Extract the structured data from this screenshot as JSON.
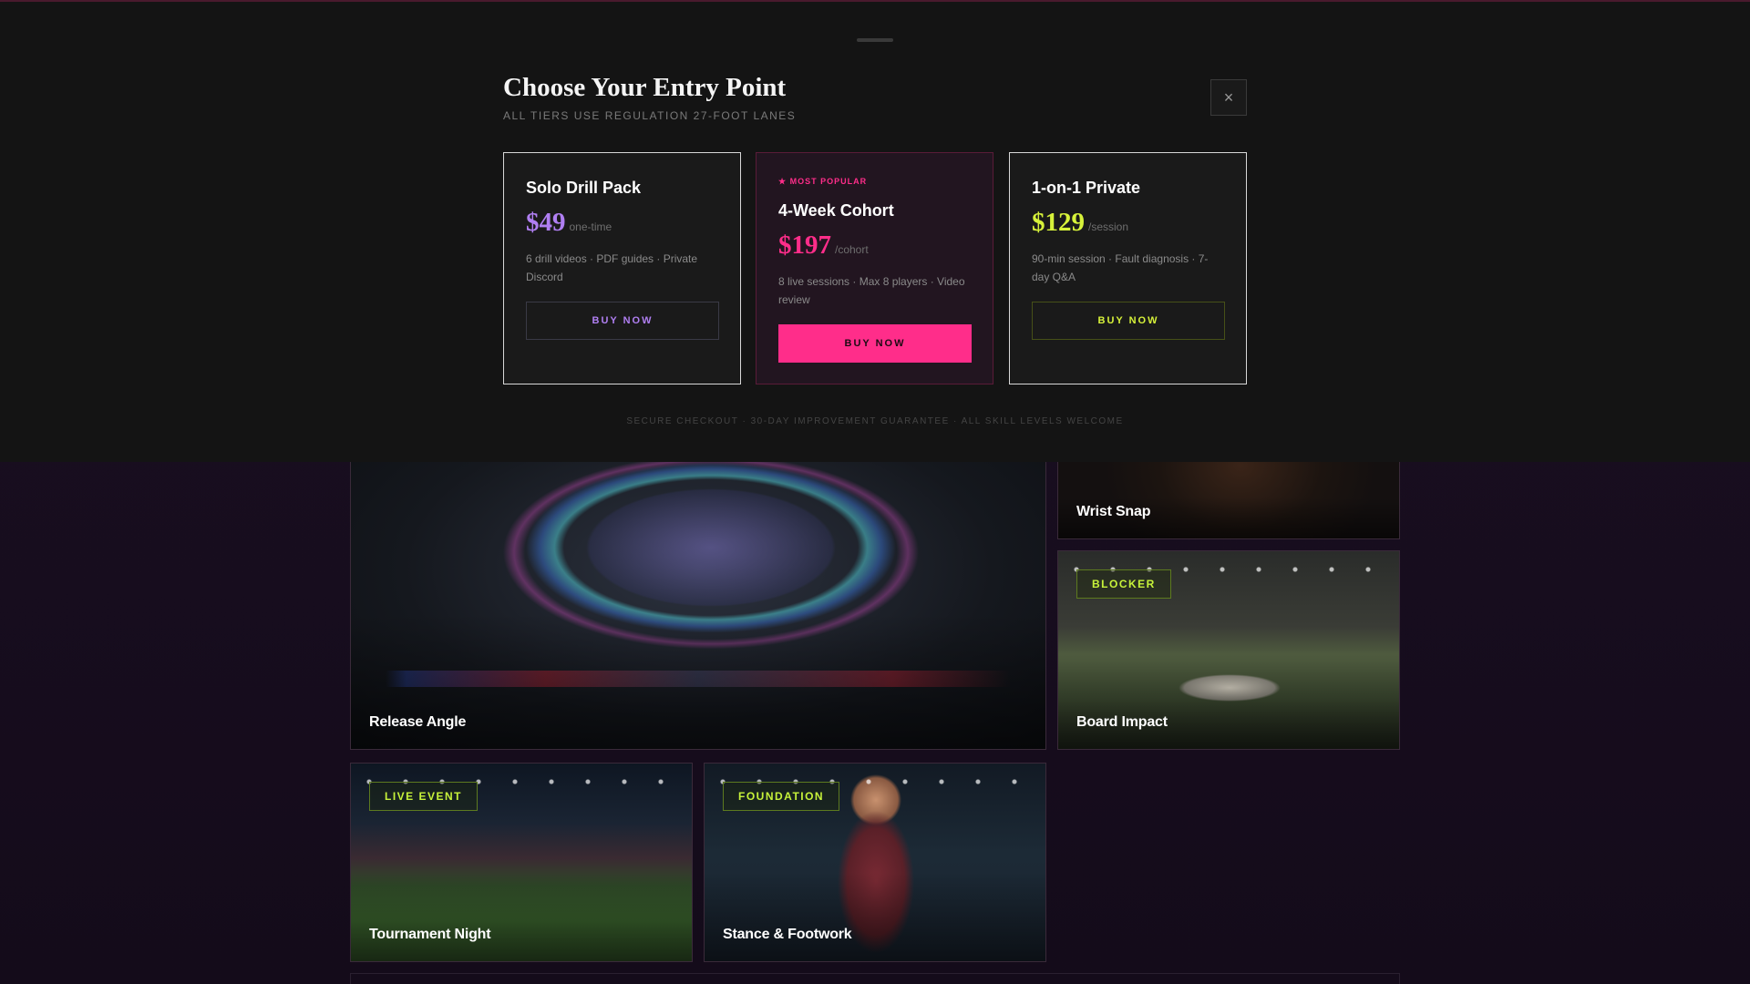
{
  "modal": {
    "title": "Choose Your Entry Point",
    "subtitle": "ALL TIERS USE REGULATION 27-FOOT LANES",
    "close_icon": "×",
    "assurance": "SECURE CHECKOUT · 30-DAY IMPROVEMENT GUARANTEE · ALL SKILL LEVELS WELCOME",
    "tiers": [
      {
        "name": "Solo Drill Pack",
        "price": "$49",
        "unit": "one-time",
        "features": "6 drill videos · PDF guides · Private Discord",
        "button": "BUY NOW",
        "accent": "#b07ff2"
      },
      {
        "badge": "★ MOST POPULAR",
        "name": "4-Week Cohort",
        "price": "$197",
        "unit": "/cohort",
        "features": "8 live sessions · Max 8 players · Video review",
        "button": "BUY NOW",
        "accent": "#ff2d8a"
      },
      {
        "name": "1-on-1 Private",
        "price": "$129",
        "unit": "/session",
        "features": "90-min session · Fault diagnosis · 7-day Q&A",
        "button": "BUY NOW",
        "accent": "#d7f23a"
      }
    ]
  },
  "gallery": {
    "tiles": [
      {
        "title": "Release Angle"
      },
      {
        "title": "Wrist Snap"
      },
      {
        "title": "Board Impact",
        "tag": "BLOCKER"
      },
      {
        "title": "Tournament Night",
        "tag": "LIVE EVENT"
      },
      {
        "title": "Stance & Footwork",
        "tag": "FOUNDATION"
      }
    ]
  }
}
